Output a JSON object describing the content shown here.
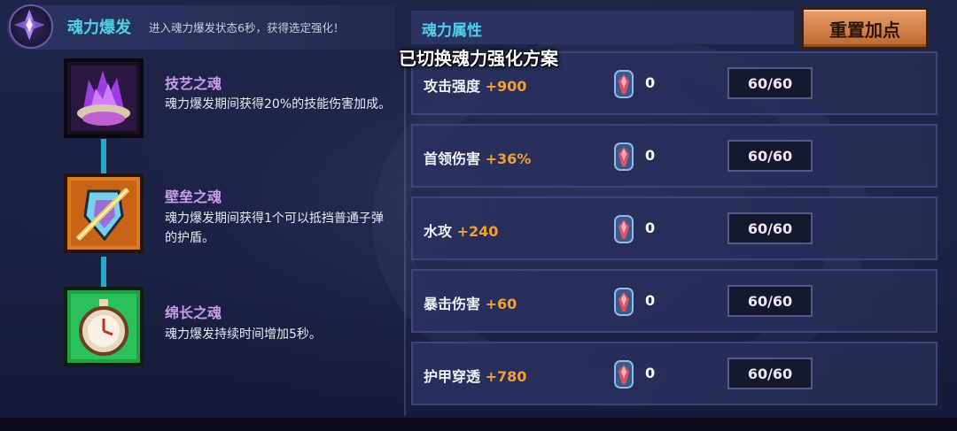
{
  "soul_burst": {
    "title": "魂力爆发",
    "description": "进入魂力爆发状态6秒，获得选定强化！"
  },
  "souls": [
    {
      "name": "技艺之魂",
      "description": "魂力爆发期间获得20%的技能伤害加成。",
      "icon": "flame-bowl-icon"
    },
    {
      "name": "壁垒之魂",
      "description": "魂力爆发期间获得1个可以抵挡普通子弹的护盾。",
      "icon": "shield-sword-icon"
    },
    {
      "name": "绵长之魂",
      "description": "魂力爆发持续时间增加5秒。",
      "icon": "stopwatch-icon"
    }
  ],
  "attributes": {
    "title": "魂力属性",
    "reset_label": "重置加点",
    "rows": [
      {
        "name": "攻击强度",
        "bonus": "+900",
        "gems": "0",
        "level": "60/60"
      },
      {
        "name": "首领伤害",
        "bonus": "+36%",
        "gems": "0",
        "level": "60/60"
      },
      {
        "name": "水攻",
        "bonus": "+240",
        "gems": "0",
        "level": "60/60"
      },
      {
        "name": "暴击伤害",
        "bonus": "+60",
        "gems": "0",
        "level": "60/60"
      },
      {
        "name": "护甲穿透",
        "bonus": "+780",
        "gems": "0",
        "level": "60/60"
      }
    ]
  },
  "toast": "已切换魂力强化方案",
  "colors": {
    "accent_cyan": "#4fd0e8",
    "bonus_orange": "#f0a030",
    "soul_name_purple": "#c99ce6",
    "reset_button": "#d07e46"
  }
}
